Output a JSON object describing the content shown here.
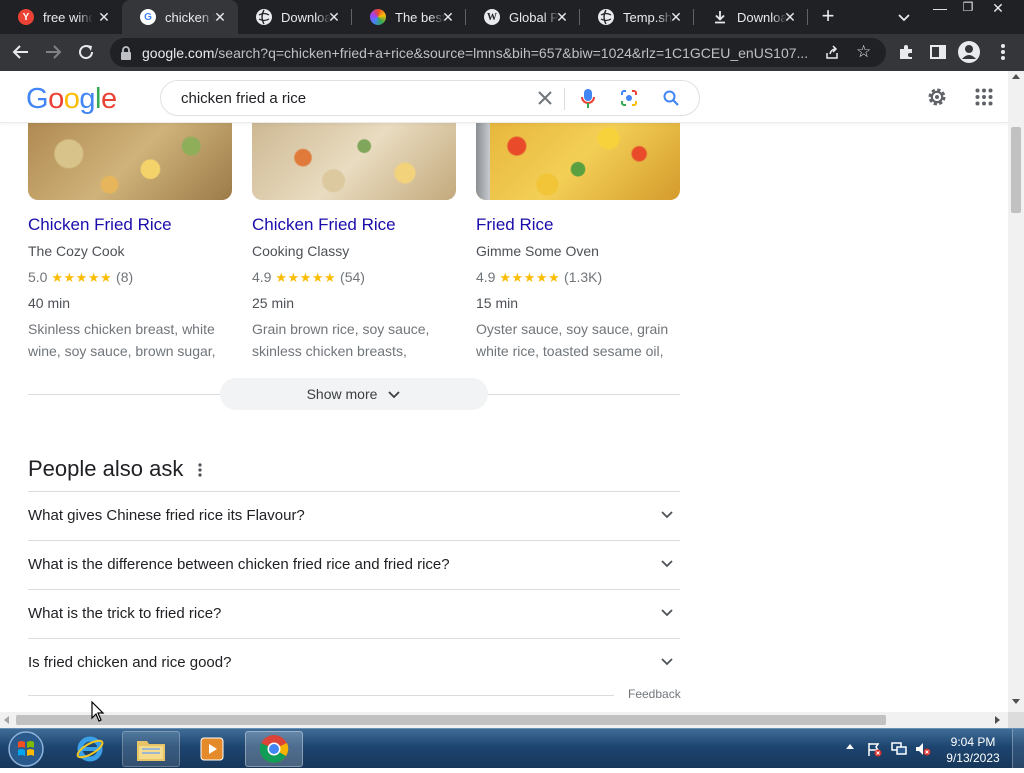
{
  "tabs": [
    {
      "title": "free wind",
      "icon": "yandex-icon"
    },
    {
      "title": "chicken fr",
      "icon": "google-icon",
      "active": true
    },
    {
      "title": "Downloa",
      "icon": "globe-icon"
    },
    {
      "title": "The best",
      "icon": "colorwheel-icon"
    },
    {
      "title": "Global PC",
      "icon": "wordpress-icon"
    },
    {
      "title": "Temp.sh |",
      "icon": "globe-icon"
    },
    {
      "title": "Downloa",
      "icon": "download-icon"
    }
  ],
  "address_bar": {
    "host": "google.com",
    "path": "/search?q=chicken+fried+a+rice&source=lmns&bih=657&biw=1024&rlz=1C1GCEU_enUS107..."
  },
  "google": {
    "logo": "Google",
    "query": "chicken fried a rice"
  },
  "recipes": [
    {
      "title": "Chicken Fried Rice",
      "source": "The Cozy Cook",
      "rating": "5.0",
      "stars": "★★★★★",
      "reviews": "(8)",
      "time": "40 min",
      "ingredients": "Skinless chicken breast, white wine, soy sauce, brown sugar,"
    },
    {
      "title": "Chicken Fried Rice",
      "source": "Cooking Classy",
      "rating": "4.9",
      "stars": "★★★★★",
      "reviews": "(54)",
      "time": "25 min",
      "ingredients": "Grain brown rice, soy sauce, skinless chicken breasts,"
    },
    {
      "title": "Fried Rice",
      "source": "Gimme Some Oven",
      "rating": "4.9",
      "stars": "★★★★★",
      "reviews": "(1.3K)",
      "time": "15 min",
      "ingredients": "Oyster sauce, soy sauce, grain white rice, toasted sesame oil,"
    }
  ],
  "show_more": "Show more",
  "people_also_ask": {
    "title": "People also ask",
    "questions": [
      "What gives Chinese fried rice its Flavour?",
      "What is the difference between chicken fried rice and fried rice?",
      "What is the trick to fried rice?",
      "Is fried chicken and rice good?"
    ]
  },
  "feedback": "Feedback",
  "taskbar": {
    "time": "9:04 PM",
    "date": "9/13/2023"
  },
  "colors": {
    "link": "#1a0dab",
    "star": "#fbbc04",
    "chrome_dark": "#202124"
  }
}
